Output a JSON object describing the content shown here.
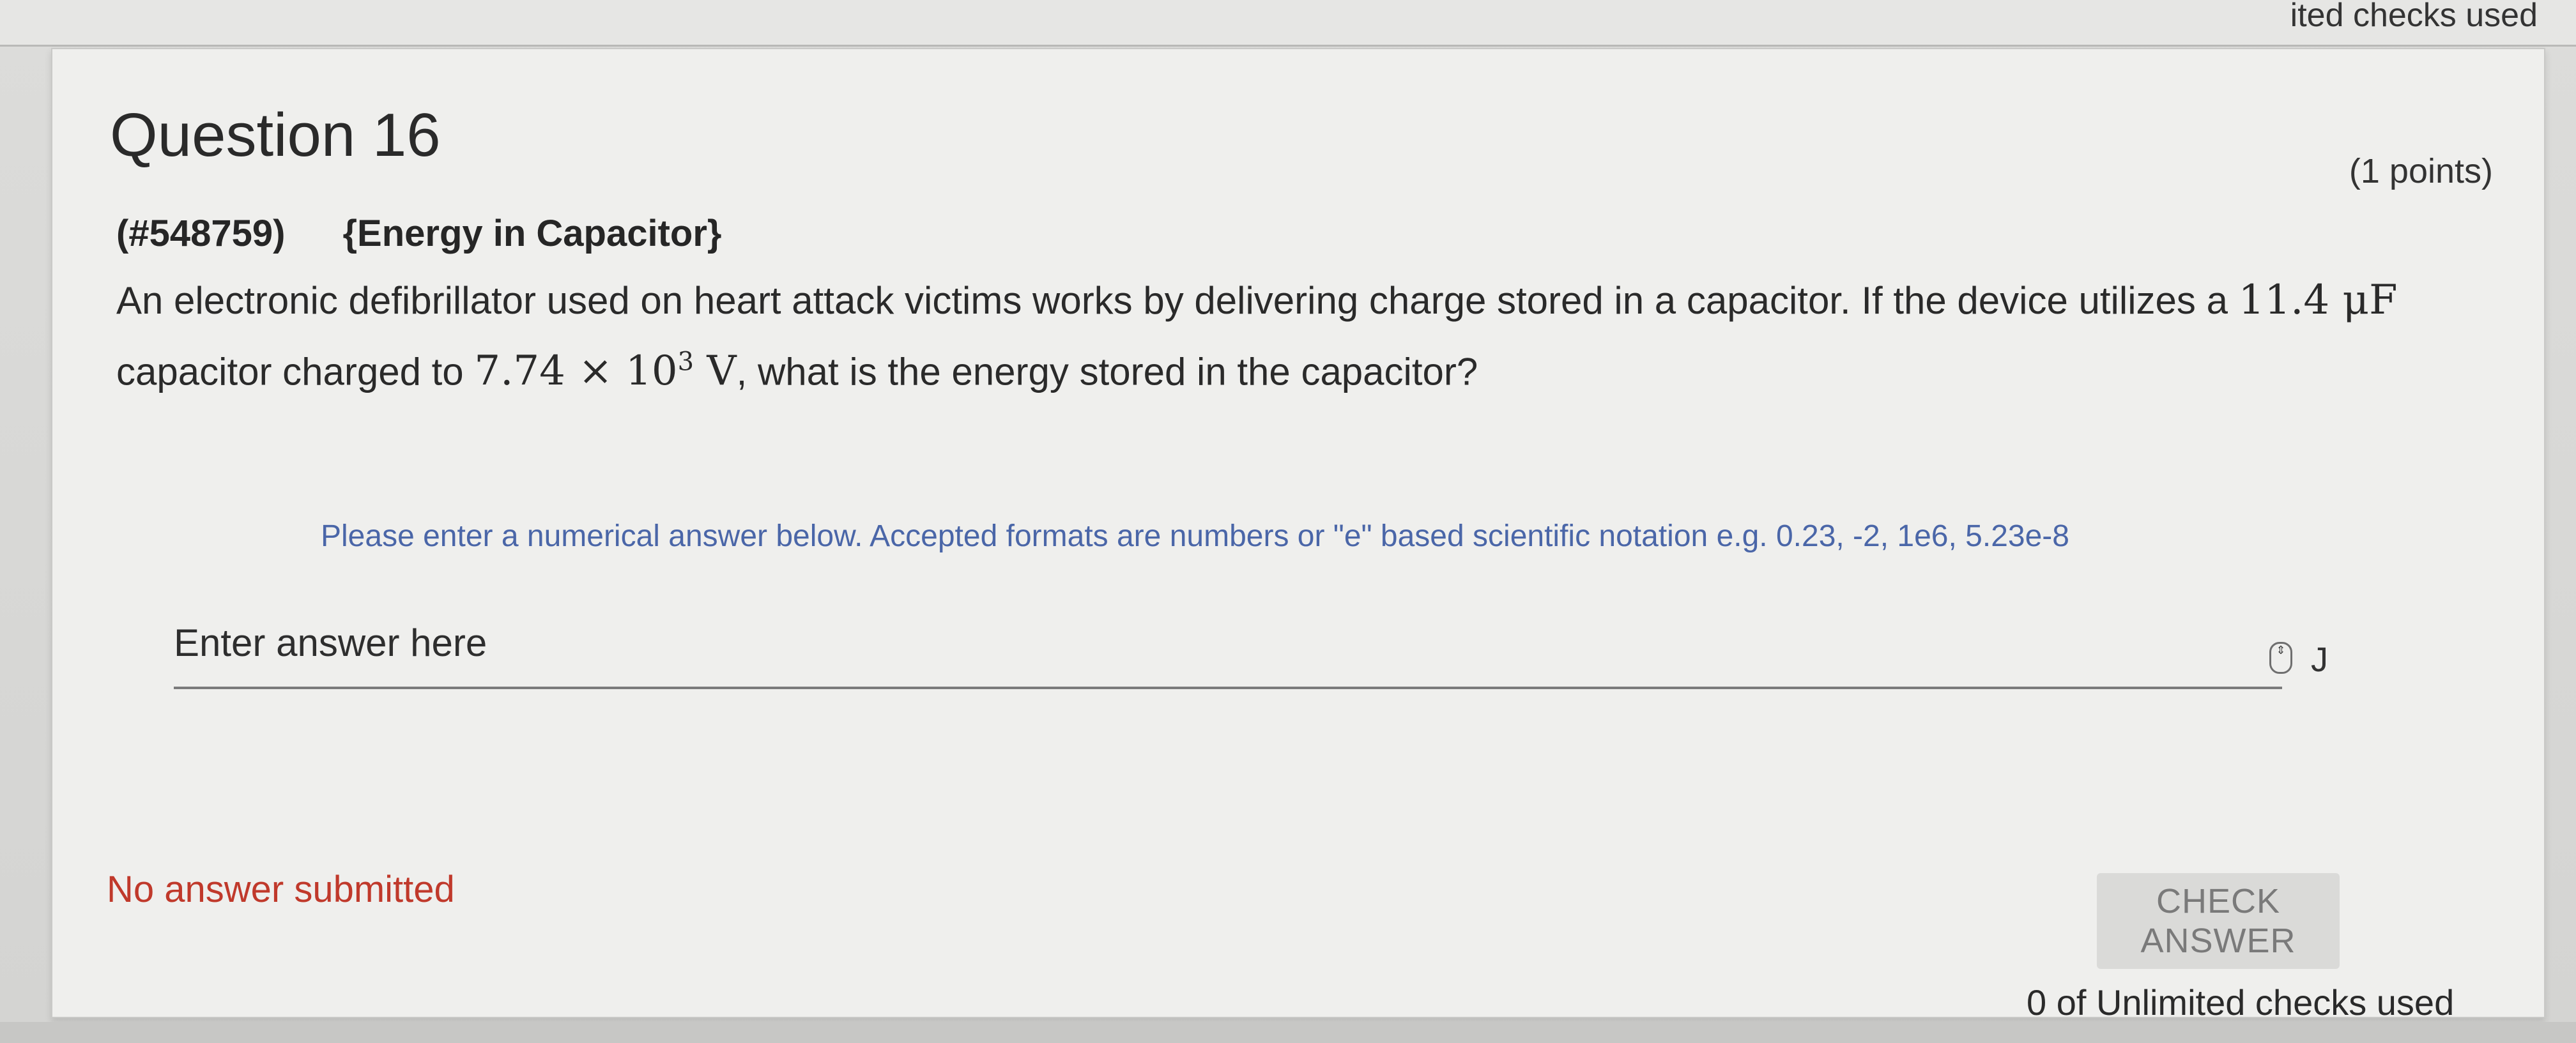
{
  "previous_question": {
    "checks_used_fragment": "ited checks used"
  },
  "question": {
    "title": "Question 16",
    "points": "(1 points)",
    "id": "(#548759)",
    "category": "{Energy in Capacitor}",
    "text_part1": "An electronic defibrillator used on heart attack victims works by delivering charge stored in a capacitor.  If the device utilizes a ",
    "capacitance": "11.4 μF",
    "text_part2": " capacitor charged to ",
    "voltage_mantissa": "7.74 × 10",
    "voltage_exponent": "3",
    "voltage_unit": " V",
    "text_part3": ", what is the energy stored in the capacitor?"
  },
  "answer": {
    "hint": "Please enter a numerical answer below. Accepted formats are numbers or \"e\" based scientific notation e.g. 0.23, -2, 1e6, 5.23e-8",
    "placeholder": "Enter answer here",
    "value": "",
    "unit": "J"
  },
  "status": {
    "message": "No answer submitted",
    "message_color": "#c0392b"
  },
  "actions": {
    "check_label": "CHECK ANSWER",
    "checks_used": "0 of Unlimited checks used"
  }
}
